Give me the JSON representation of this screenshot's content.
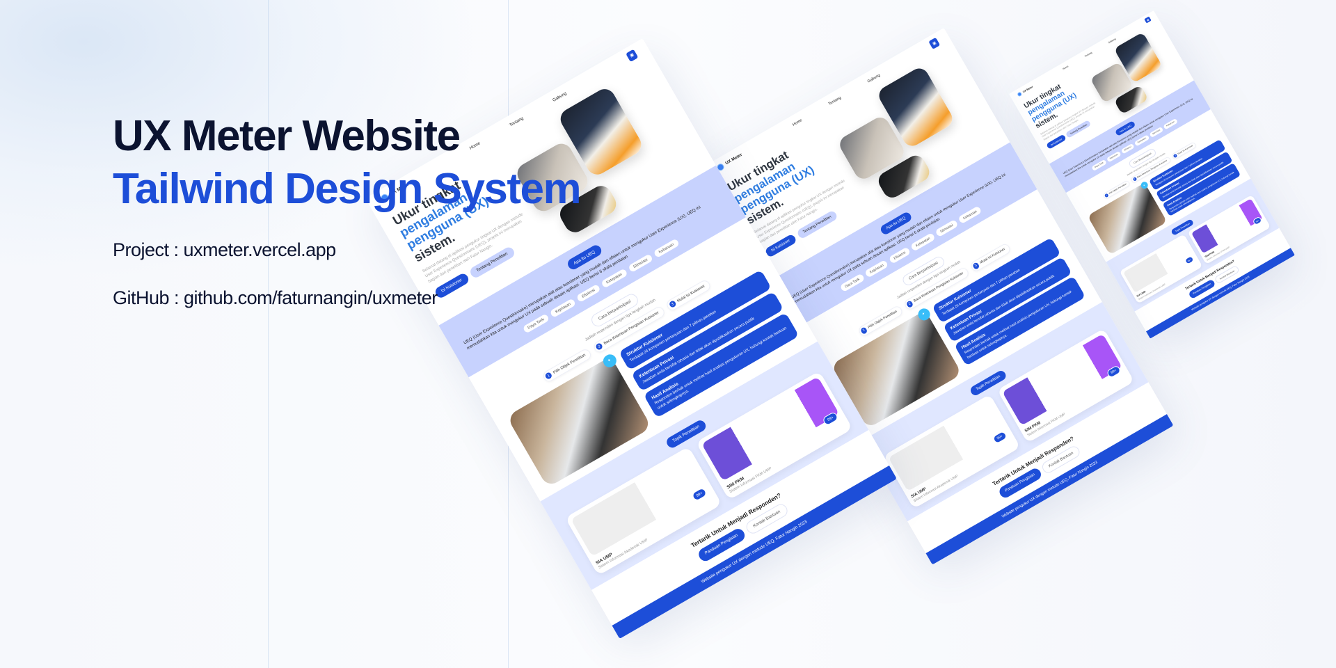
{
  "headline": {
    "line1": "UX Meter Website",
    "line2": "Tailwind Design System"
  },
  "project": "Project  : uxmeter.vercel.app",
  "github": "GitHub : github.com/faturnangin/uxmeter",
  "mock": {
    "logo": "UX Meter",
    "nav": [
      "Home",
      "Tentang",
      "Gabung"
    ],
    "hero": {
      "title_dark": "Ukur tingkat",
      "title_blue": "pengalaman pengguna (UX)",
      "title_end": "sistem.",
      "desc": "Selamat datang di aplikasi pengukur tingkat UX dengan metode User Experience Questionnaire (UEQ), proyek ini merupakan bagian dari penelitian oleh Fatur Nangin.",
      "primary": "Isi Kuisioner",
      "secondary": "Tentang Penelitian"
    },
    "ueq": {
      "pill": "Apa itu UEQ",
      "text": "UEQ (User Experience Questionnaire) merupakan alat atau kuesioner yang mudah dan efisien untuk mengukur User Experience (UX). UEQ ini memudahkan kita untuk mengukur UX pada sebuah desain aplikasi. UEQ berisi 6 skala penilaian",
      "scales": [
        "Daya Tarik",
        "Kejelasan",
        "Efisiensi",
        "Ketepatan",
        "Stimulasi",
        "Kebaruan"
      ]
    },
    "part": {
      "pill": "Cara Berpartisipasi",
      "sub": "Jadilah responden dengan tiga langkah mudah",
      "steps": [
        {
          "n": "1",
          "label": "Pilih Objek Penelitian"
        },
        {
          "n": "2",
          "label": "Baca Ketentuan Pengisian Kuisioner"
        },
        {
          "n": "3",
          "label": "Mulai Isi Kuisioner"
        }
      ],
      "cards": [
        {
          "title": "Struktur Kuisioner",
          "text": "Terdapat 26 komponen pertanyaan dan 7 pilihan jawaban"
        },
        {
          "title": "Ketentuan Privasi",
          "text": "Jawaban anda bersifat rahasia dan tidak akan dipublikasikan secara publik"
        },
        {
          "title": "Hasil Analisis",
          "text": "Responden berhak untuk melihat hasil analisis pengukuran UX, hubungi kontak bantuan untuk selengkapnya."
        }
      ]
    },
    "topik": {
      "pill": "Topik Penelitian",
      "items": [
        {
          "name": "SIA UMP",
          "desc": "Sistem Informasi Akademik UMP",
          "badge": "99+"
        },
        {
          "name": "SIM PKM",
          "desc": "Sistem Informasi PKM UMP",
          "badge": "99+"
        }
      ]
    },
    "cta": {
      "title": "Tertarik Untuk Menjadi Responden?",
      "primary": "Panduan Pengisian",
      "secondary": "Kontak Bantuan"
    },
    "footer": "Website pengukur UX dengan metode UEQ, Fatur Nangin 2023"
  }
}
